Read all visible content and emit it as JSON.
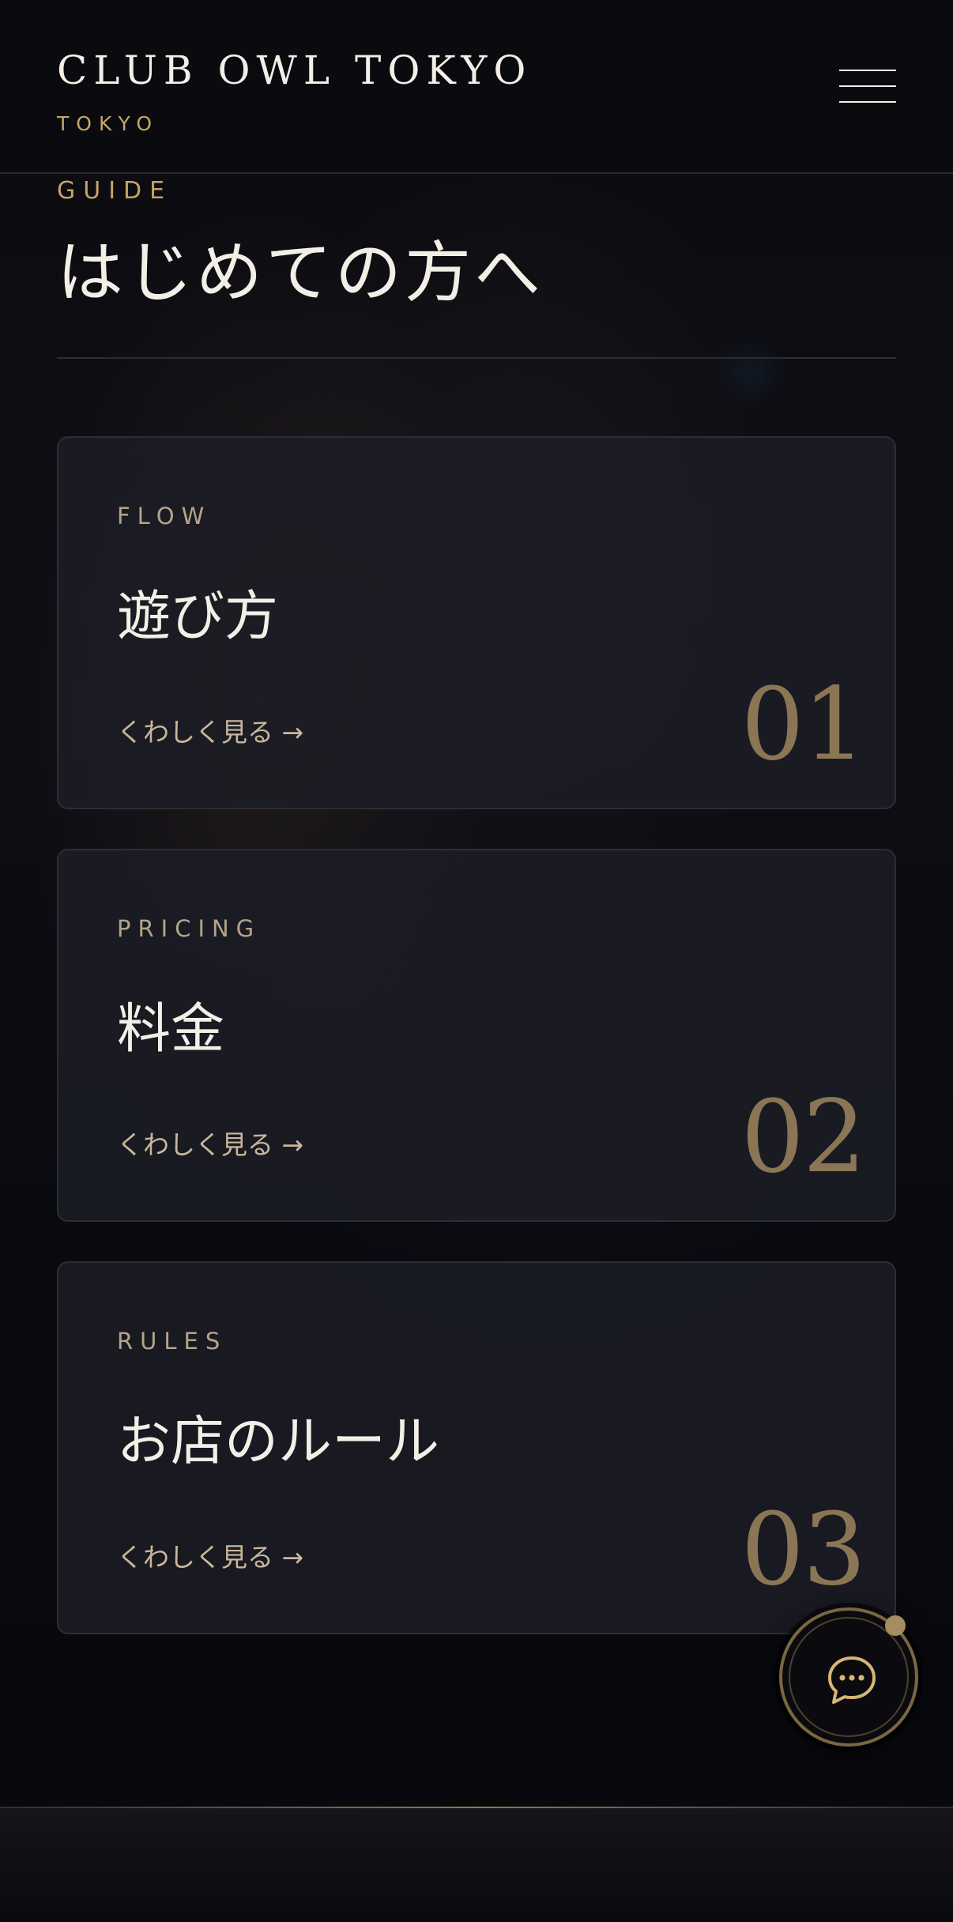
{
  "header": {
    "brand": "CLUB OWL TOKYO",
    "brand_sub": "TOKYO",
    "menu_icon": "hamburger-menu-icon"
  },
  "section": {
    "eyebrow": "GUIDE",
    "title": "はじめての方へ"
  },
  "cards": [
    {
      "eyebrow": "FLOW",
      "title": "遊び方",
      "link": "くわしく見る →",
      "number": "01"
    },
    {
      "eyebrow": "PRICING",
      "title": "料金",
      "link": "くわしく見る →",
      "number": "02"
    },
    {
      "eyebrow": "RULES",
      "title": "お店のルール",
      "link": "くわしく見る →",
      "number": "03"
    }
  ],
  "chat": {
    "icon": "chat-bubble-icon",
    "notification_dot": true
  },
  "colors": {
    "accent_gold": "#c7a768",
    "background": "#08090d",
    "card_bg": "#1c1d26",
    "text_primary": "#f3efe7"
  }
}
